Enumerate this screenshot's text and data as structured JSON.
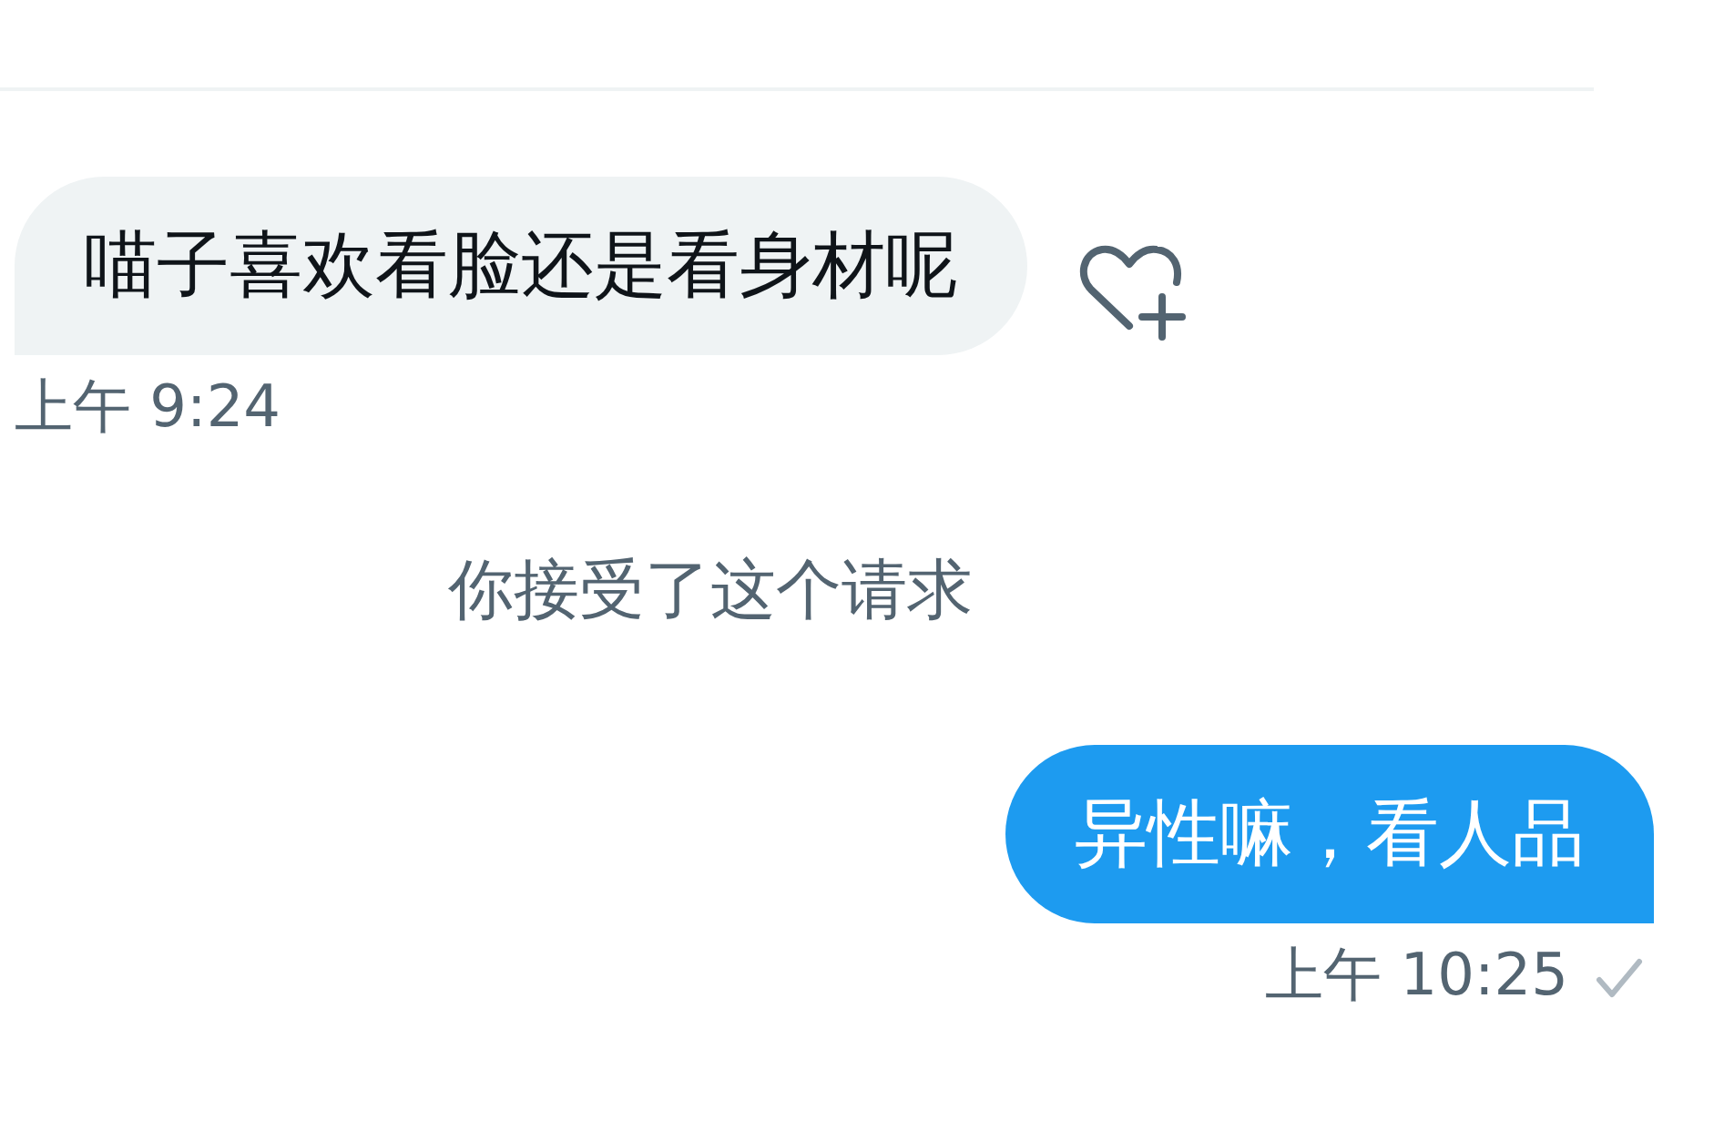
{
  "messages": [
    {
      "kind": "received",
      "text": "喵子喜欢看脸还是看身材呢",
      "time": "上午 9:24"
    },
    {
      "kind": "system",
      "text": "你接受了这个请求"
    },
    {
      "kind": "sent",
      "text": "异性嘛，看人品",
      "time": "上午 10:25",
      "seen": true
    }
  ]
}
